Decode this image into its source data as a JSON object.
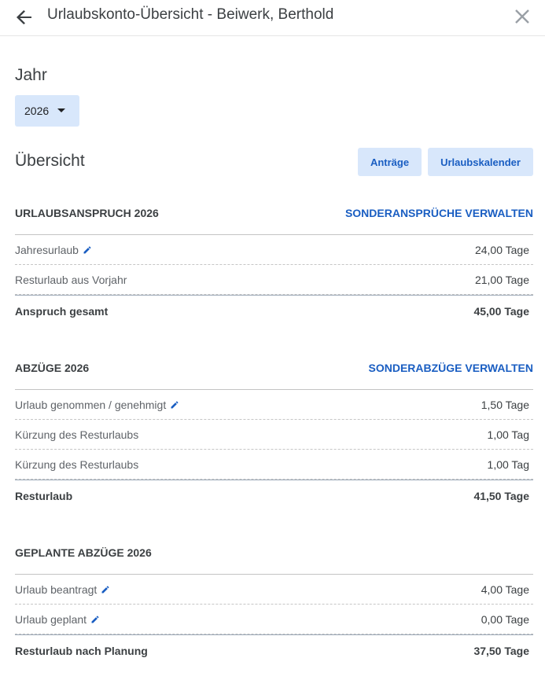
{
  "header": {
    "title": "Urlaubskonto-Übersicht - Beiwerk, Berthold",
    "back_icon": "arrow-back-icon",
    "close_icon": "close-icon"
  },
  "year": {
    "label": "Jahr",
    "selected": "2026"
  },
  "overview": {
    "label": "Übersicht",
    "antraege_button": "Anträge",
    "kalender_button": "Urlaubskalender"
  },
  "colors": {
    "accent": "#1a5ec2",
    "button_bg": "#d8e7fb",
    "text": "#3c4043"
  },
  "anspruch": {
    "title": "URLAUBSANSPRUCH 2026",
    "link": "SONDERANSPRÜCHE VERWALTEN",
    "rows": [
      {
        "label": "Jahresurlaub",
        "value": "24,00 Tage"
      },
      {
        "label": "Resturlaub aus Vorjahr",
        "value": "21,00 Tage"
      }
    ],
    "total": {
      "label": "Anspruch gesamt",
      "value": "45,00 Tage"
    }
  },
  "abzuege": {
    "title": "ABZÜGE 2026",
    "link": "SONDERABZÜGE VERWALTEN",
    "rows": [
      {
        "label": "Urlaub genommen / genehmigt",
        "value": "1,50 Tage"
      },
      {
        "label": "Kürzung des Resturlaubs",
        "value": "1,00 Tag"
      },
      {
        "label": "Kürzung des Resturlaubs",
        "value": "1,00 Tag"
      }
    ],
    "total": {
      "label": "Resturlaub",
      "value": "41,50 Tage"
    }
  },
  "geplant": {
    "title": "GEPLANTE ABZÜGE 2026",
    "rows": [
      {
        "label": "Urlaub beantragt",
        "value": "4,00 Tage"
      },
      {
        "label": "Urlaub geplant",
        "value": "0,00 Tage"
      }
    ],
    "total": {
      "label": "Resturlaub nach Planung",
      "value": "37,50 Tage"
    }
  }
}
